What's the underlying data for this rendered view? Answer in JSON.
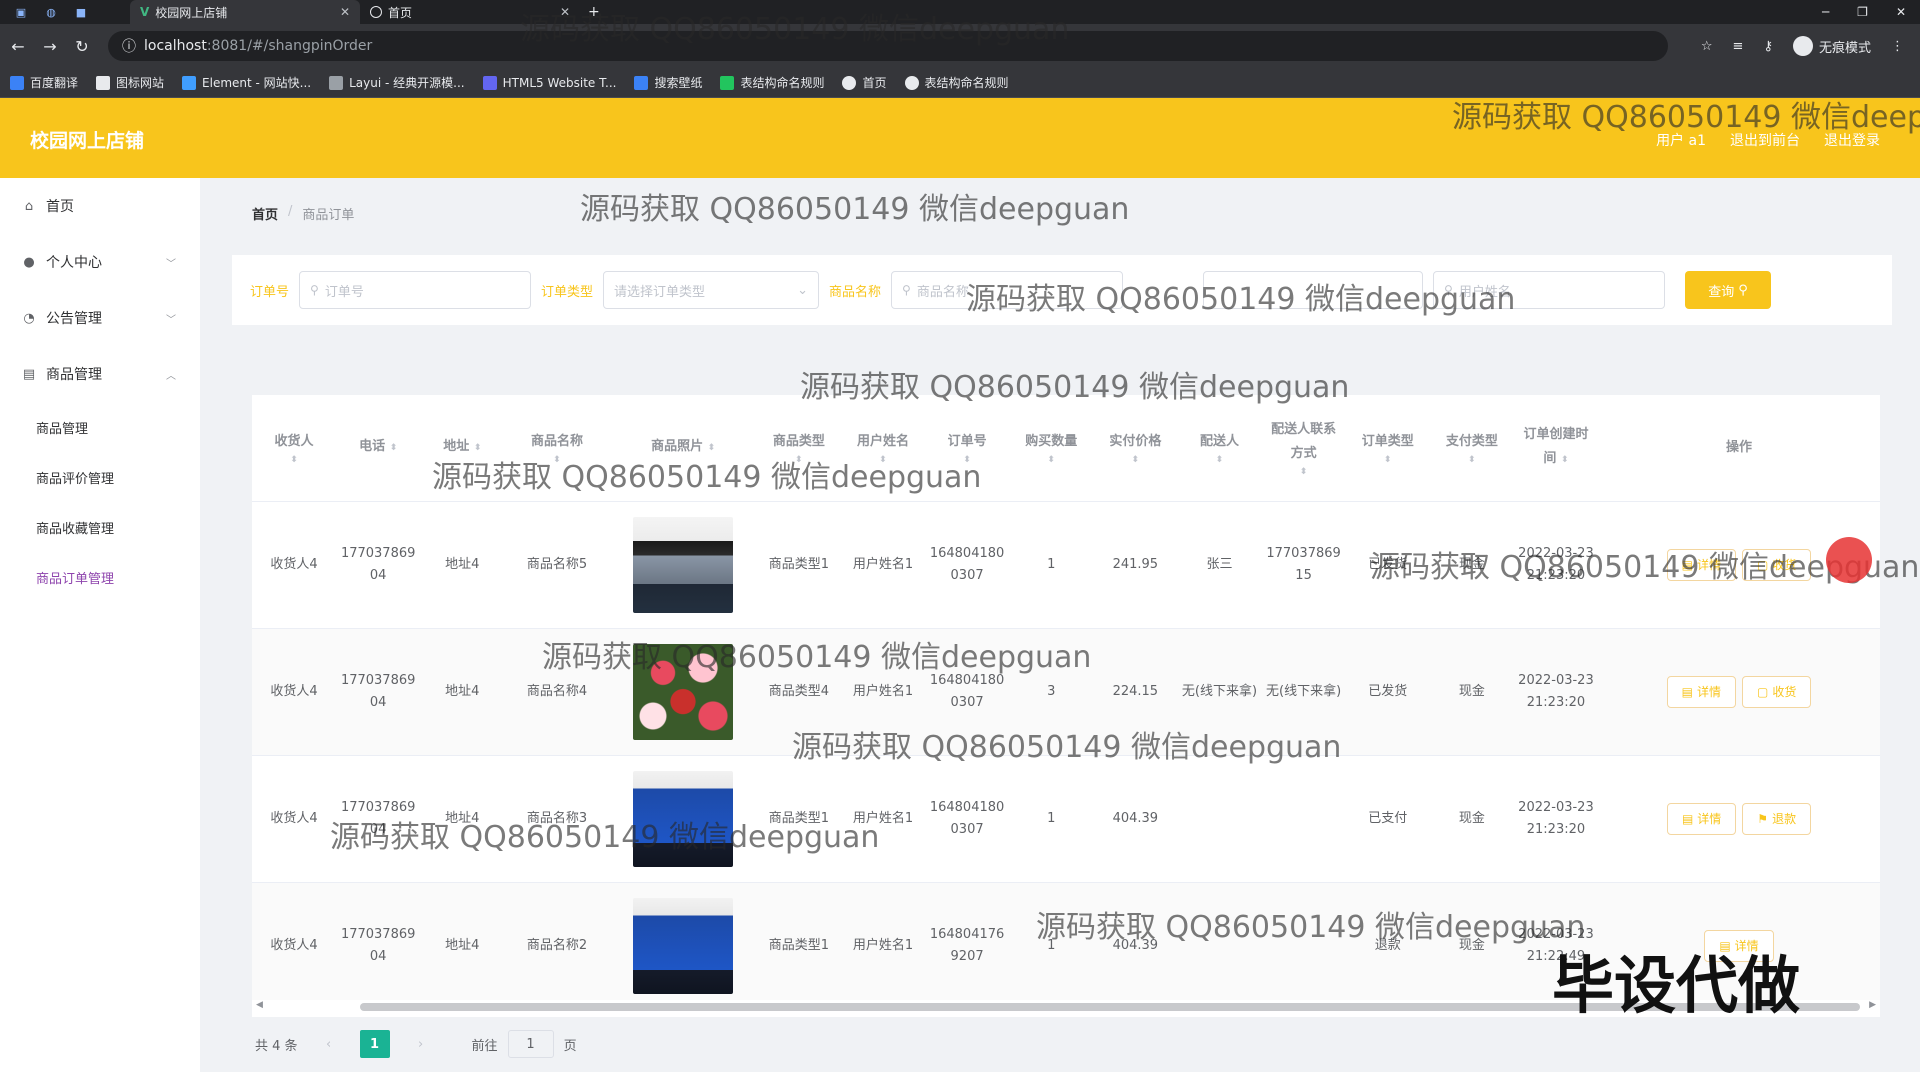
{
  "browser": {
    "active_tab": "校园网上店铺",
    "inactive_tab": "首页",
    "url_host": "localhost",
    "url_path": ":8081/#/shangpinOrder",
    "incognito_label": "无痕模式",
    "bookmarks": [
      "百度翻译",
      "图标网站",
      "Element - 网站快...",
      "Layui - 经典开源模...",
      "HTML5 Website T...",
      "搜索壁纸",
      "表结构命名规则",
      "首页",
      "表结构命名规则"
    ]
  },
  "header": {
    "brand": "校园网上店铺",
    "user": "用户 a1",
    "back_front": "退出到前台",
    "logout": "退出登录"
  },
  "sidebar": {
    "items": [
      {
        "label": "首页",
        "icon": "home-icon"
      },
      {
        "label": "个人中心",
        "icon": "user-icon"
      },
      {
        "label": "公告管理",
        "icon": "notice-icon"
      },
      {
        "label": "商品管理",
        "icon": "goods-icon"
      }
    ],
    "subitems": [
      "商品管理",
      "商品评价管理",
      "商品收藏管理",
      "商品订单管理"
    ]
  },
  "breadcrumb": {
    "home": "首页",
    "current": "商品订单"
  },
  "filters": {
    "order_no_label": "订单号",
    "order_no_placeholder": "订单号",
    "order_type_label": "订单类型",
    "order_type_placeholder": "请选择订单类型",
    "goods_name_label": "商品名称",
    "goods_name_placeholder": "商品名称",
    "username_placeholder": "用户姓名",
    "query_label": "查询"
  },
  "table": {
    "headers": [
      "收货人",
      "电话",
      "地址",
      "商品名称",
      "商品照片",
      "商品类型",
      "用户姓名",
      "订单号",
      "购买数量",
      "实付价格",
      "配送人",
      "配送人联系方式",
      "订单类型",
      "支付类型",
      "订单创建时间",
      "操作"
    ],
    "rows": [
      {
        "receiver": "收货人4",
        "phone": "17703786904",
        "address": "地址4",
        "goods": "商品名称5",
        "photo": "t1",
        "type": "商品类型1",
        "user": "用户姓名1",
        "order_no": "1648041800307",
        "qty": "1",
        "price": "241.95",
        "courier": "张三",
        "courier_phone": "17703786915",
        "order_type": "已发货",
        "pay_type": "现金",
        "created": "2022-03-23 21:23:20",
        "ops": [
          "详情",
          "收货"
        ]
      },
      {
        "receiver": "收货人4",
        "phone": "17703786904",
        "address": "地址4",
        "goods": "商品名称4",
        "photo": "t2",
        "type": "商品类型4",
        "user": "用户姓名1",
        "order_no": "1648041800307",
        "qty": "3",
        "price": "224.15",
        "courier": "无(线下来拿)",
        "courier_phone": "无(线下来拿)",
        "order_type": "已发货",
        "pay_type": "现金",
        "created": "2022-03-23 21:23:20",
        "ops": [
          "详情",
          "收货"
        ]
      },
      {
        "receiver": "收货人4",
        "phone": "17703786904",
        "address": "地址4",
        "goods": "商品名称3",
        "photo": "t3",
        "type": "商品类型1",
        "user": "用户姓名1",
        "order_no": "1648041800307",
        "qty": "1",
        "price": "404.39",
        "courier": "",
        "courier_phone": "",
        "order_type": "已支付",
        "pay_type": "现金",
        "created": "2022-03-23 21:23:20",
        "ops": [
          "详情",
          "退款"
        ]
      },
      {
        "receiver": "收货人4",
        "phone": "17703786904",
        "address": "地址4",
        "goods": "商品名称2",
        "photo": "t3",
        "type": "商品类型1",
        "user": "用户姓名1",
        "order_no": "1648041769207",
        "qty": "1",
        "price": "404.39",
        "courier": "",
        "courier_phone": "",
        "order_type": "退款",
        "pay_type": "现金",
        "created": "2022-03-23 21:22:49",
        "ops": [
          "详情"
        ]
      }
    ]
  },
  "pager": {
    "total": "共 4 条",
    "page": "1",
    "goto": "前往",
    "goto_value": "1",
    "page_unit": "页"
  },
  "watermark": "源码获取 QQ86050149 微信deepguan",
  "corner_mark": "毕设代做",
  "colors": {
    "accent": "#f8c51c",
    "active_sub": "#8e44ad",
    "page_active": "#1ab394"
  }
}
